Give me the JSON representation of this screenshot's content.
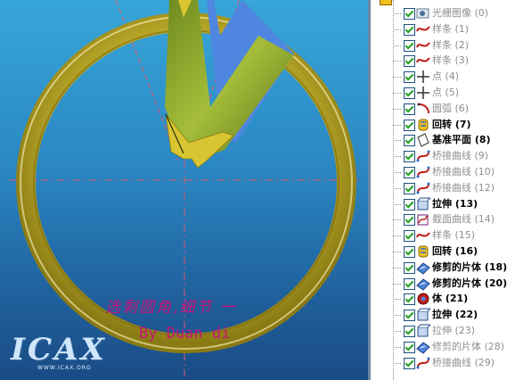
{
  "viewport": {
    "caption_line1": "选剩圆角,细节  一",
    "caption_line2": "By Duan di",
    "logo": {
      "text": "ICAX",
      "url": "WWW.ICAX.ORG"
    },
    "colors": {
      "ring": "#e0cc3a",
      "surface_green": "#8ea52f",
      "surface_blue": "#4f86e0",
      "guide": "#e0566e",
      "caption": "#c4157a"
    }
  },
  "tree": {
    "items": [
      {
        "label": "光栅图像 (0)",
        "icon": "raster-image-icon",
        "dim": true
      },
      {
        "label": "样条 (1)",
        "icon": "spline-icon",
        "dim": true
      },
      {
        "label": "样条 (2)",
        "icon": "spline-icon",
        "dim": true
      },
      {
        "label": "样条 (3)",
        "icon": "spline-icon",
        "dim": true
      },
      {
        "label": "点 (4)",
        "icon": "point-icon",
        "dim": true
      },
      {
        "label": "点 (5)",
        "icon": "point-icon",
        "dim": true
      },
      {
        "label": "圆弧 (6)",
        "icon": "arc-icon",
        "dim": true
      },
      {
        "label": "回转 (7)",
        "icon": "revolve-icon",
        "dim": false
      },
      {
        "label": "基准平面 (8)",
        "icon": "datum-plane-icon",
        "dim": false
      },
      {
        "label": "桥接曲线 (9)",
        "icon": "bridge-curve-icon",
        "dim": true
      },
      {
        "label": "桥接曲线 (10)",
        "icon": "bridge-curve-icon",
        "dim": true
      },
      {
        "label": "桥接曲线 (12)",
        "icon": "bridge-curve-icon",
        "dim": true
      },
      {
        "label": "拉伸 (13)",
        "icon": "extrude-icon",
        "dim": false
      },
      {
        "label": "截面曲线 (14)",
        "icon": "section-curve-icon",
        "dim": true
      },
      {
        "label": "样条 (15)",
        "icon": "spline-icon",
        "dim": true
      },
      {
        "label": "回转 (16)",
        "icon": "revolve-icon",
        "dim": false
      },
      {
        "label": "修剪的片体 (18)",
        "icon": "trimmed-sheet-icon",
        "dim": false
      },
      {
        "label": "修剪的片体 (20)",
        "icon": "trimmed-sheet-icon",
        "dim": false
      },
      {
        "label": "体 (21)",
        "icon": "body-icon",
        "dim": false
      },
      {
        "label": "拉伸 (22)",
        "icon": "extrude-icon",
        "dim": false
      },
      {
        "label": "拉伸 (23)",
        "icon": "extrude-icon",
        "dim": true
      },
      {
        "label": "修剪的片体 (28)",
        "icon": "trimmed-sheet-icon",
        "dim": true
      },
      {
        "label": "桥接曲线 (29)",
        "icon": "bridge-curve-icon",
        "dim": true
      }
    ]
  }
}
